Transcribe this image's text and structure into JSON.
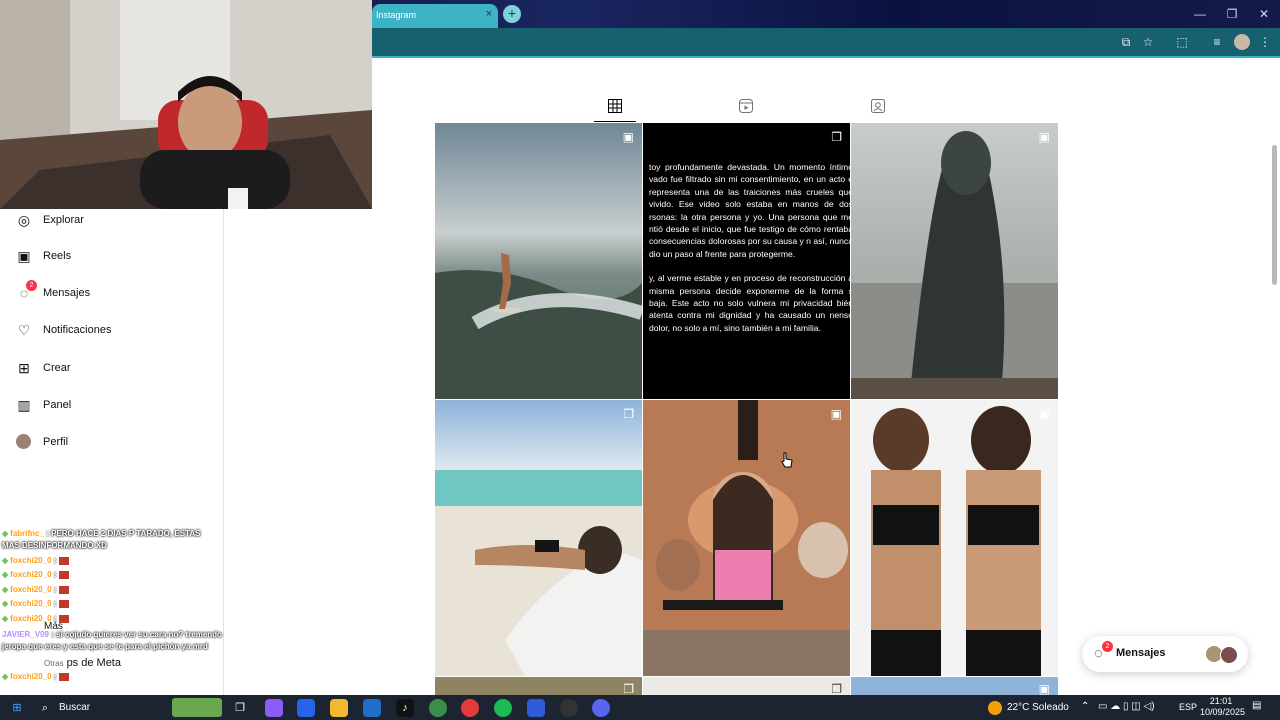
{
  "browser": {
    "tab_title": "Instagram",
    "tab_close": "×",
    "new_tab": "+",
    "window_controls": [
      "—",
      "❐",
      "✕"
    ]
  },
  "sidebar": {
    "items": [
      {
        "label": "Explorar",
        "icon": "compass-icon"
      },
      {
        "label": "Reels",
        "icon": "reels-icon"
      },
      {
        "label": "Mensajes",
        "icon": "messenger-icon",
        "badge": "2"
      },
      {
        "label": "Notificaciones",
        "icon": "heart-icon"
      },
      {
        "label": "Crear",
        "icon": "plus-square-icon"
      },
      {
        "label": "Panel",
        "icon": "bar-chart-icon"
      },
      {
        "label": "Perfil",
        "icon": "avatar"
      }
    ],
    "more_label": "Más",
    "meta_label": "ps de Meta",
    "meta_prefix": "Otras"
  },
  "chat": [
    {
      "user": "fabrifnc_",
      "text": ": PERO HACE 2 DIAS P TARADO, ESTAS",
      "text2": "MAS DESINFORMANDO XD"
    },
    {
      "user": "foxchi20_0",
      "text": ":"
    },
    {
      "user": "foxchi20_0",
      "text": ":"
    },
    {
      "user": "foxchi20_0",
      "text": ":"
    },
    {
      "user": "foxchi20_0",
      "text": ":"
    },
    {
      "user": "foxchi20_0",
      "text": ":"
    },
    {
      "user": "JAVIER_V09",
      "text": ": si cojudo quieres ver su cara no? tremendo",
      "text2": "jeropa que eres y esta que se te para el pichón ya mrd"
    },
    {
      "user": "foxchi20_0",
      "text": ":"
    }
  ],
  "profile_tabs": [
    "grid-icon",
    "reels-icon",
    "tagged-icon"
  ],
  "post_text": {
    "p1": "toy profundamente devastada. Un momento íntimo vado fue filtrado sin mi consentimiento, en un acto e representa una de las traiciones más crueles que vivido. Ese video solo estaba en manos de dos rsonas: la otra persona y yo. Una persona que me ntió desde el inicio, que fue testigo de cómo rentaba consecuencias dolorosas por su causa y n así, nunca dio un paso al frente para protegerme.",
    "p2": "y, al verme estable y en proceso de reconstrucción a misma persona decide exponerme de la forma s baja. Este acto no solo vulnera mi privacidad bién atenta contra mi dignidad y ha causado un nenso dolor, no solo a mí, sino también a mi familia."
  },
  "messages_pill": {
    "label": "Mensajes",
    "badge": "2"
  },
  "taskbar": {
    "search": "Buscar",
    "weather": "22°C  Soleado",
    "lang": "ESP",
    "time": "21:01",
    "date": "10/09/2025"
  }
}
